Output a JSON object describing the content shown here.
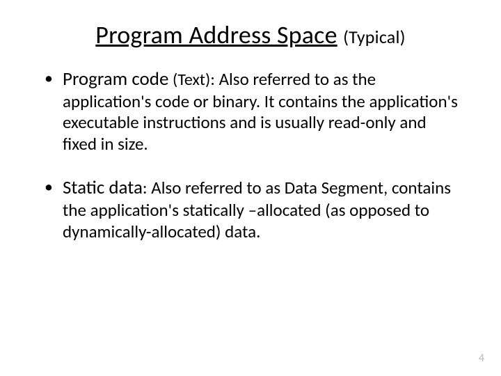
{
  "title": {
    "main": "Program Address Space",
    "sub": "(Typical)"
  },
  "bullets": [
    {
      "lead": "Program code",
      "tag": "(Text)",
      "rest": ": Also referred to as the application's code or binary. It contains the application's executable instructions and is usually read-only and fixed in size."
    },
    {
      "lead": "Static data",
      "tag": "",
      "rest": ": Also referred to as Data Segment, contains the application's statically –allocated (as opposed to dynamically-allocated) data."
    }
  ],
  "page_number": "4"
}
